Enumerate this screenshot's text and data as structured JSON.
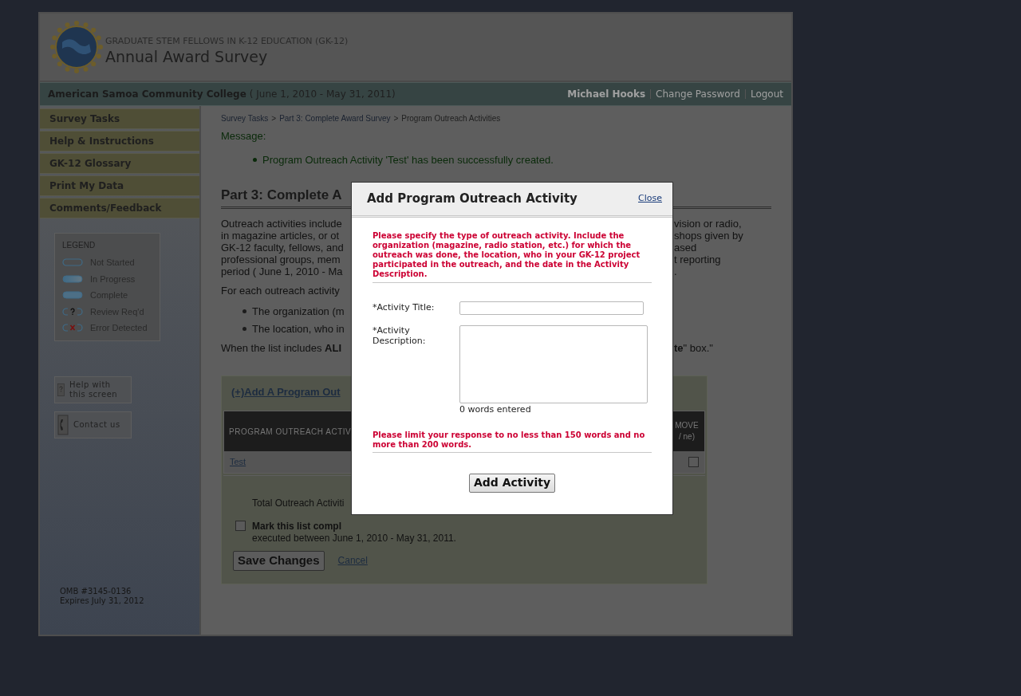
{
  "header": {
    "subtitle": "GRADUATE STEM FELLOWS IN K-12 EDUCATION (GK-12)",
    "title": "Annual Award Survey"
  },
  "bar": {
    "institution": "American Samoa Community College",
    "period": "( June 1, 2010 - May 31, 2011)",
    "user": "Michael Hooks",
    "links": [
      "Change Password",
      "Logout"
    ]
  },
  "sidebar": {
    "items": [
      {
        "label": "Survey Tasks"
      },
      {
        "label": "Help & Instructions"
      },
      {
        "label": "GK-12 Glossary"
      },
      {
        "label": "Print My Data"
      },
      {
        "label": "Comments/Feedback"
      }
    ],
    "legend": {
      "title": "LEGEND",
      "items": [
        {
          "kind": "not_started",
          "label": "Not Started"
        },
        {
          "kind": "in_progress",
          "label": "In Progress"
        },
        {
          "kind": "complete",
          "label": "Complete"
        },
        {
          "kind": "review",
          "label": "Review Req'd"
        },
        {
          "kind": "error",
          "label": "Error Detected"
        }
      ]
    },
    "help_buttons": [
      {
        "kind": "help",
        "label": "Help with this screen"
      },
      {
        "kind": "contact",
        "label": "Contact us"
      }
    ],
    "omb": [
      "OMB #3145-0136",
      "Expires July 31, 2012"
    ]
  },
  "main": {
    "breadcrumb": [
      "Survey Tasks",
      ">",
      "Part 3: Complete Award Survey",
      ">",
      "Program Outreach Activities"
    ],
    "message_label": "Message:",
    "messages": [
      "Program Outreach Activity 'Test' has been successfully created."
    ],
    "heading": "Part 3: Complete A",
    "intro_lines": [
      [
        "Outreach activities include",
        "vision or radio,"
      ],
      [
        "in magazine articles, or ot",
        "shops given by"
      ],
      [
        "GK-12 faculty, fellows, and",
        "ased"
      ],
      [
        "professional groups, mem",
        "t reporting"
      ],
      [
        "period ( June 1, 2010 - Ma",
        "."
      ]
    ],
    "for_each": "For each outreach activity",
    "bullets": [
      "The organization (m",
      "The location, who in"
    ],
    "when_line": [
      "When the list includes **ALI**",
      "**te**\" box.\""
    ],
    "panel": {
      "add_link": "(+)Add A Program Out",
      "columns": [
        "PROGRAM OUTREACH ACTIV",
        "MOVE / ne)"
      ],
      "rows": [
        {
          "title": "Test",
          "checked": false
        }
      ],
      "total": "Total Outreach Activiti",
      "mark": {
        "label": "Mark this list compl",
        "note": "executed between June 1, 2010 - May 31, 2011.",
        "checked": false
      },
      "save": "Save Changes",
      "cancel": "Cancel"
    }
  },
  "dialog": {
    "title": "Add Program Outreach Activity",
    "close": "Close",
    "instructions": "Please specify the type of outreach activity. Include the organization (magazine, radio station, etc.) for which the outreach was done, the location, who in your GK-12 project participated in the outreach, and the date in the Activity Description.",
    "title_label": "*Activity Title:",
    "description_label": "*Activity Description:",
    "word_count": "0 words entered",
    "limit": "Please limit your response to no less than 150 words and no more than 200 words.",
    "submit": "Add Activity"
  }
}
